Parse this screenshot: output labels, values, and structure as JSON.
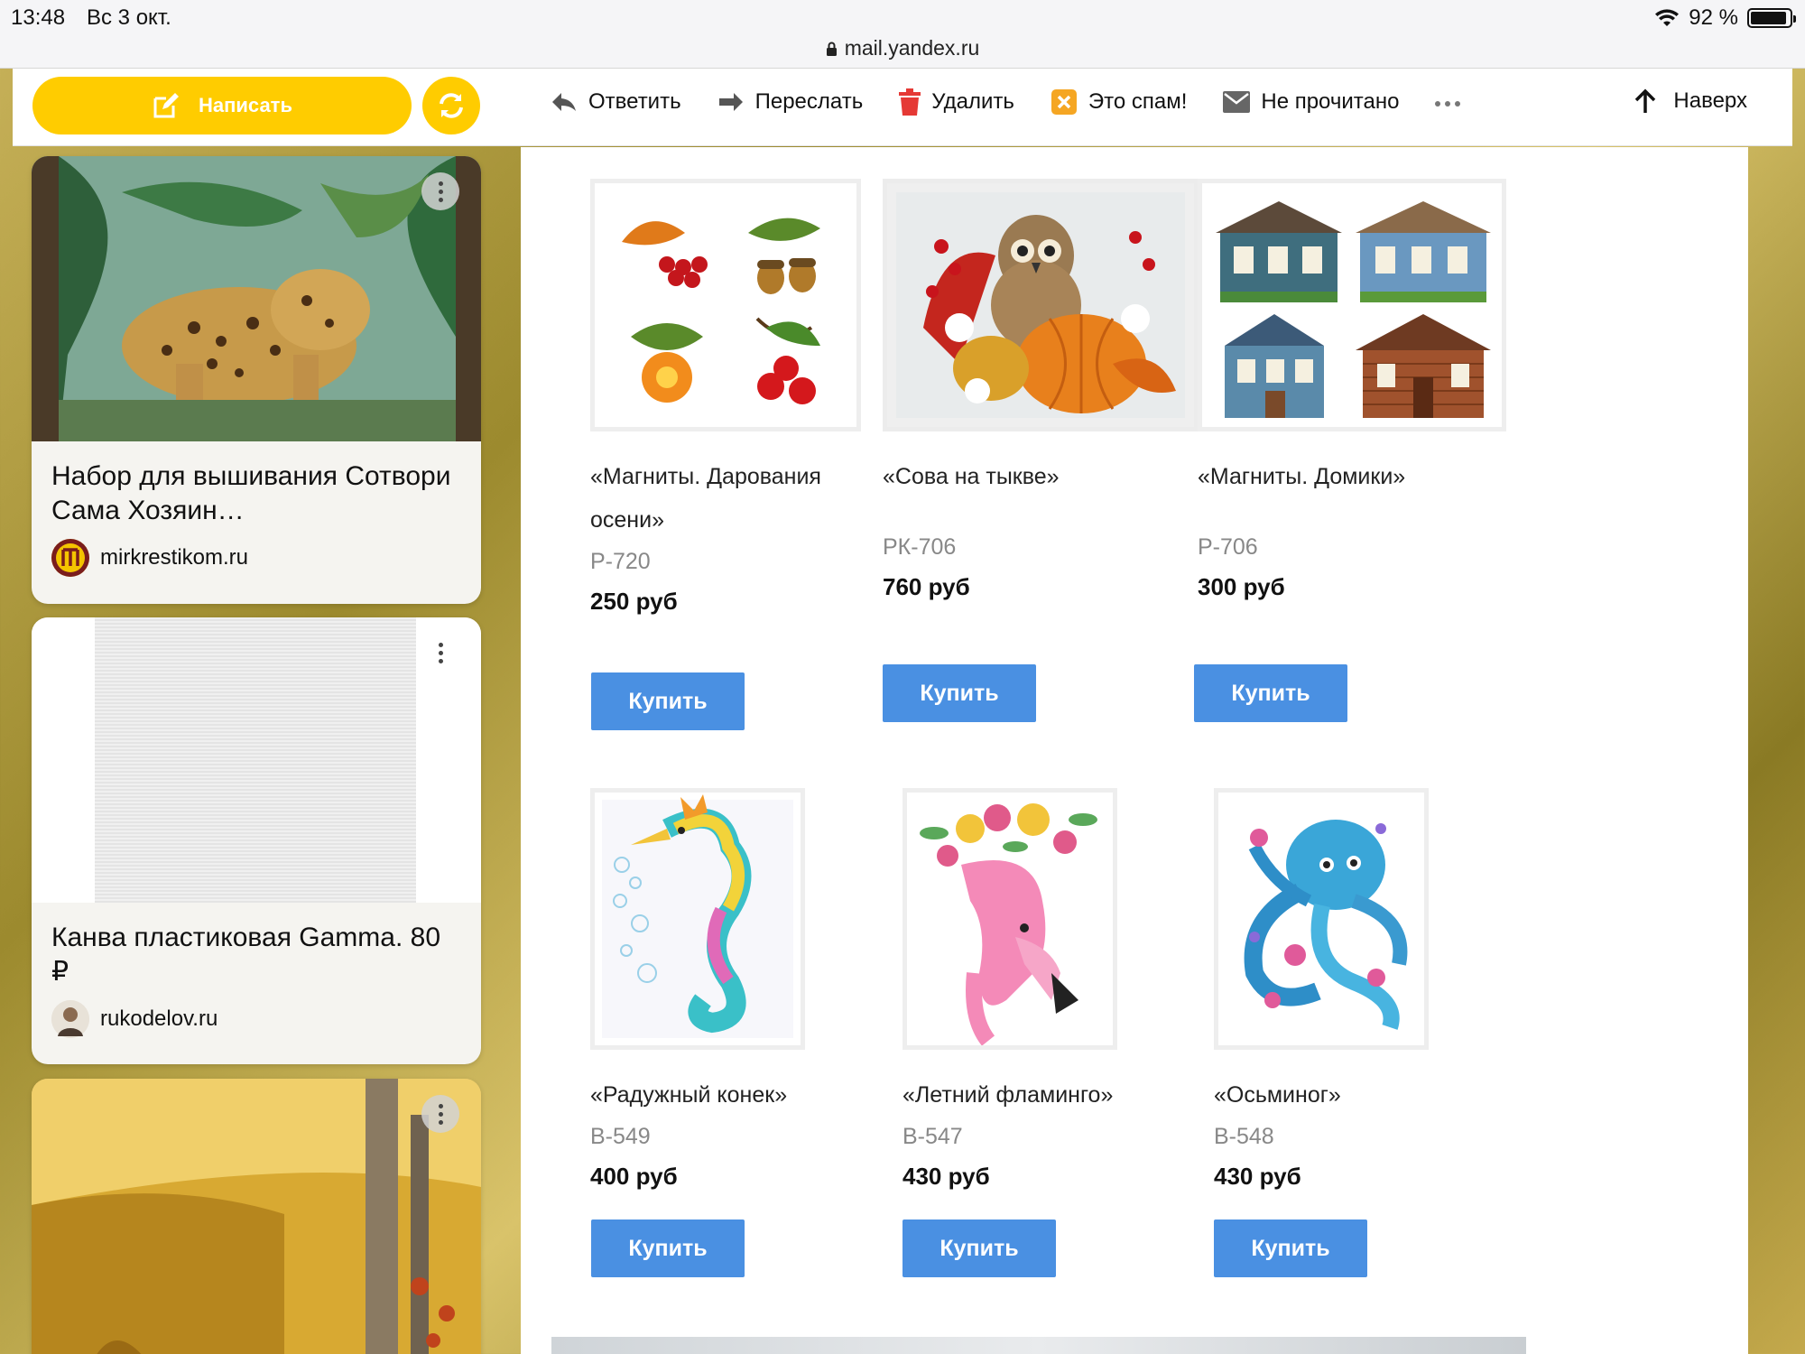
{
  "status_bar": {
    "time": "13:48",
    "date": "Вс 3 окт.",
    "url": "mail.yandex.ru",
    "battery": "92 %",
    "battery_level": 0.92
  },
  "toolbar": {
    "compose_label": "Написать",
    "reply_label": "Ответить",
    "forward_label": "Переслать",
    "delete_label": "Удалить",
    "spam_label": "Это спам!",
    "unread_label": "Не прочитано",
    "top_label": "Наверх",
    "accent_color": "#ffcc00"
  },
  "ads": [
    {
      "title": "Набор для вышивания Сотвори Сама Хозяин…",
      "source": "mirkrestikom.ru"
    },
    {
      "title": "Канва пластиковая Gamma. 80 ₽",
      "source": "rukodelov.ru"
    }
  ],
  "products": [
    {
      "name": "«Магниты. Дарования осени»",
      "code": "Р-720",
      "price": "250 руб",
      "buy": "Купить"
    },
    {
      "name": "«Сова на тыкве»",
      "code": "РК-706",
      "price": "760 руб",
      "buy": "Купить"
    },
    {
      "name": "«Магниты. Домики»",
      "code": "Р-706",
      "price": "300 руб",
      "buy": "Купить"
    },
    {
      "name": "«Радужный конек»",
      "code": "В-549",
      "price": "400 руб",
      "buy": "Купить"
    },
    {
      "name": "«Летний фламинго»",
      "code": "В-547",
      "price": "430 руб",
      "buy": "Купить"
    },
    {
      "name": "«Осьминог»",
      "code": "В-548",
      "price": "430 руб",
      "buy": "Купить"
    }
  ],
  "buy_button_color": "#4a90e2"
}
